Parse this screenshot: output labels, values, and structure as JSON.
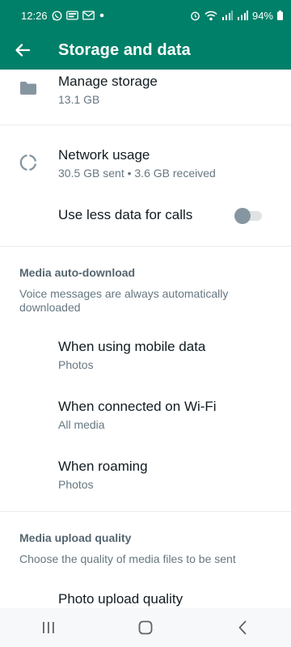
{
  "status_bar": {
    "time": "12:26",
    "battery": "94%",
    "left_icons": [
      "whatsapp-icon",
      "message-icon",
      "email-icon",
      "dot-icon"
    ],
    "right_icons": [
      "alarm-icon",
      "wifi-icon",
      "signal-icon",
      "signal-icon",
      "battery-icon"
    ]
  },
  "app_bar": {
    "title": "Storage and data",
    "back_icon": "arrow-left-icon",
    "color": "#008069"
  },
  "storage": {
    "manage": {
      "title": "Manage storage",
      "subtitle": "13.1 GB",
      "icon": "folder-icon"
    },
    "network": {
      "title": "Network usage",
      "subtitle": "30.5 GB sent • 3.6 GB received",
      "icon": "data-usage-icon"
    },
    "less_data": {
      "title": "Use less data for calls",
      "enabled": false
    }
  },
  "media_auto_download": {
    "header": "Media auto-download",
    "description": "Voice messages are always automatically downloaded",
    "items": [
      {
        "title": "When using mobile data",
        "subtitle": "Photos"
      },
      {
        "title": "When connected on Wi-Fi",
        "subtitle": "All media"
      },
      {
        "title": "When roaming",
        "subtitle": "Photos"
      }
    ]
  },
  "media_upload_quality": {
    "header": "Media upload quality",
    "description": "Choose the quality of media files to be sent",
    "items": [
      {
        "title": "Photo upload quality"
      }
    ]
  },
  "nav_bar": {
    "buttons": [
      "recents-icon",
      "home-icon",
      "back-icon"
    ]
  }
}
